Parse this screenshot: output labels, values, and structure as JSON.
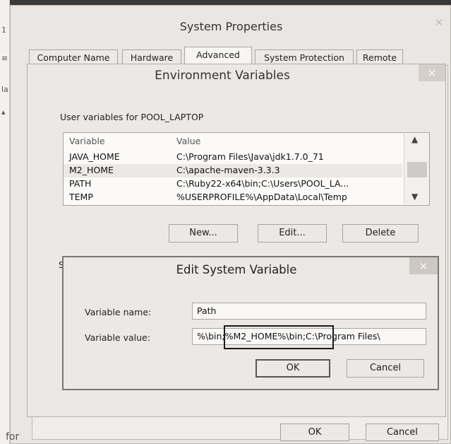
{
  "system_properties": {
    "title": "System Properties",
    "close": "×",
    "tabs": [
      "Computer Name",
      "Hardware",
      "Advanced",
      "System Protection",
      "Remote"
    ],
    "active_tab": "Advanced",
    "ok_label": "OK",
    "cancel_label": "Cancel"
  },
  "background": {
    "left_glyphs": [
      "1",
      "≡",
      "la",
      "▴"
    ],
    "bottom_left_text": "for"
  },
  "environment_variables": {
    "title": "Environment Variables",
    "close": "×",
    "user_vars_label": "User variables for POOL_LAPTOP",
    "columns": [
      "Variable",
      "Value"
    ],
    "rows": [
      {
        "variable": "JAVA_HOME",
        "value": "C:\\Program Files\\Java\\jdk1.7.0_71"
      },
      {
        "variable": "M2_HOME",
        "value": "C:\\apache-maven-3.3.3"
      },
      {
        "variable": "PATH",
        "value": "C:\\Ruby22-x64\\bin;C:\\Users\\POOL_LA..."
      },
      {
        "variable": "TEMP",
        "value": "%USERPROFILE%\\AppData\\Local\\Temp"
      }
    ],
    "selected_row": 1,
    "new_label": "New...",
    "edit_label": "Edit...",
    "delete_label": "Delete",
    "system_vars_label_stub": "S"
  },
  "edit_system_variable": {
    "title": "Edit System Variable",
    "close": "×",
    "name_label": "Variable name:",
    "name_value": "Path",
    "value_label": "Variable value:",
    "value_value": "%\\bin;%M2_HOME%\\bin;C:\\Program Files\\",
    "ok_label": "OK",
    "cancel_label": "Cancel"
  }
}
